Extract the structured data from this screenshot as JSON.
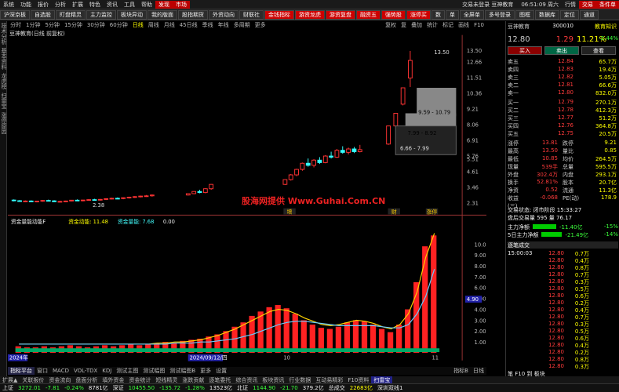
{
  "menu": {
    "items": [
      "系统",
      "功能",
      "报价",
      "分析",
      "扩展",
      "特色",
      "资讯",
      "工具",
      "帮助"
    ],
    "highlight": [
      "发现",
      "市场"
    ],
    "login_status": "交易未登录",
    "app_name": "豆神教育",
    "time": "06:51:09 周六",
    "right_buttons": [
      "行情",
      "交易",
      "条件单"
    ]
  },
  "toolbar": {
    "buttons": [
      "沪深京板",
      "自选股",
      "盯盘精灵",
      "主力监控",
      "板块异动",
      "我的版面",
      "股指期货",
      "外资动向",
      "财联社",
      "金钱指标",
      "游资龙虎",
      "游资复盘",
      "融资五",
      "强势股",
      "涨停买",
      "数",
      "单",
      "全屏单",
      "多号登录",
      "图框",
      "数据库",
      "定位",
      "通道"
    ]
  },
  "tabs": [
    "分时",
    "1分钟",
    "5分钟",
    "15分钟",
    "30分钟",
    "60分钟",
    "日线",
    "周线",
    "月线",
    "45日线",
    "季线",
    "年线",
    "多周期",
    "更多"
  ],
  "tabs_active": "日线",
  "tabs_right": [
    "复权",
    "复",
    "叠加",
    "统计",
    "标记",
    "画线",
    "F10"
  ],
  "chart_title": "豆神教育(日线 前复权)",
  "price_axis": [
    "13.50",
    "12.66",
    "11.51",
    "10.36",
    "9.21",
    "8.06",
    "6.91",
    "5.76",
    "5.51",
    "4.61",
    "3.46",
    "2.31"
  ],
  "price_annotations": {
    "high": "13.50",
    "low": "2.38",
    "range1": "9.59 - 10.79",
    "range2": "7.99 - 8.92",
    "range3": "6.66 - 7.99"
  },
  "event_markers": [
    "增",
    "财",
    "涨停"
  ],
  "watermark": "股海网提供 Www.Guhai.Com.CN",
  "indicator": {
    "title": "资金量能动能F",
    "label1": "资金动能: 11.48",
    "label2": "资金量能: 7.68",
    "label3": "0.00",
    "axis": [
      "10.00",
      "9.00",
      "8.00",
      "7.00",
      "6.00",
      "5.00",
      "4.00",
      "3.00",
      "2.00",
      "1.00"
    ],
    "current": "4.90"
  },
  "date_labels": [
    "2024年",
    "2024/09/12/四",
    "10",
    "11"
  ],
  "indicator_tabs": [
    "指标平台",
    "窗口",
    "MACD",
    "VOL-TDX",
    "KDJ",
    "测试主图",
    "测试幅图",
    "测试幅图B",
    "更多",
    "设置"
  ],
  "indicator_tabs_right": [
    "指标B",
    "日线"
  ],
  "bottom_tabs": [
    "扩展▲",
    "关联报价",
    "资金流向",
    "盘面分析",
    "填外资金",
    "资金统计",
    "短线精灵",
    "涨跌贡献",
    "逐笔委托",
    "综合资讯",
    "板块资讯",
    "行业数据",
    "互动易精彩",
    "F10资料"
  ],
  "bottom_tabs_right": [
    "扫雷宝"
  ],
  "status": {
    "sh_label": "上证",
    "sh_val": "3272.01",
    "sh_chg": "-7.81",
    "sh_pct": "-0.24%",
    "sh_amt": "8781亿",
    "sz_label": "深证",
    "sz_val": "10455.50",
    "sz_chg": "-135.72",
    "sz_pct": "-1.28%",
    "sz_amt": "13523亿",
    "bj_label": "北证",
    "bj_val": "1144.90",
    "bj_chg": "-21.70",
    "bj_amt": "379.2亿",
    "total_label": "总成交",
    "total_val": "22683亿",
    "link": "深圳双线1"
  },
  "quote": {
    "name": "豆神教育",
    "code": "300010",
    "price": "12.80",
    "change": "1.29",
    "change_pct": "11.21%",
    "header_tag": "教育知识",
    "header_pct": "-2.44%",
    "buttons": [
      "买入",
      "卖出",
      "查看"
    ],
    "asks": [
      {
        "label": "卖五",
        "price": "12.84",
        "vol": "65.7万"
      },
      {
        "label": "卖四",
        "price": "12.83",
        "vol": "19.4万"
      },
      {
        "label": "卖三",
        "price": "12.82",
        "vol": "5.05万"
      },
      {
        "label": "卖二",
        "price": "12.81",
        "vol": "66.6万"
      },
      {
        "label": "卖一",
        "price": "12.80",
        "vol": "832.0万"
      }
    ],
    "bids": [
      {
        "label": "买一",
        "price": "12.79",
        "vol": "270.1万"
      },
      {
        "label": "买二",
        "price": "12.78",
        "vol": "412.3万"
      },
      {
        "label": "买三",
        "price": "12.77",
        "vol": "51.2万"
      },
      {
        "label": "买四",
        "price": "12.76",
        "vol": "364.8万"
      },
      {
        "label": "买五",
        "price": "12.75",
        "vol": "20.5万"
      }
    ],
    "stats": [
      {
        "l1": "涨停",
        "v1": "13.81",
        "l2": "跌停",
        "v2": "9.21"
      },
      {
        "l1": "最高",
        "v1": "13.50",
        "l2": "量比",
        "v2": "0.85"
      },
      {
        "l1": "最低",
        "v1": "10.85",
        "l2": "均价",
        "v2": "264.5万"
      },
      {
        "l1": "现量",
        "v1": "539手",
        "l2": "总量",
        "v2": "595.5万"
      },
      {
        "l1": "外盘",
        "v1": "302.4万",
        "l2": "内盘",
        "v2": "293.1万"
      },
      {
        "l1": "换手",
        "v1": "52.81%",
        "l2": "股本",
        "v2": "20.7亿"
      },
      {
        "l1": "净资",
        "v1": "0.52",
        "l2": "流通",
        "v2": "11.3亿"
      },
      {
        "l1": "收益(三)",
        "v1": "-0.068",
        "l2": "PE(动)",
        "v2": "178.9"
      }
    ],
    "status_line": "交易状态: 闭市阶段 15:33:27",
    "after_hours": "盘后交易量 595 量 76.17",
    "main_net1_label": "主力净额",
    "main_net1_val": "-11.40亿",
    "main_net1_pct": "-15%",
    "main_net5_label": "5日主力净额",
    "main_net5_val": "-21.49亿",
    "main_net5_pct": "-14%"
  },
  "trades": {
    "title": "逐笔成交",
    "rows": [
      {
        "t": "15:00:03",
        "p": "12.80",
        "v": "0.7万"
      },
      {
        "t": "",
        "p": "12.80",
        "v": "0.4万"
      },
      {
        "t": "",
        "p": "12.80",
        "v": "0.8万"
      },
      {
        "t": "",
        "p": "12.80",
        "v": "0.7万"
      },
      {
        "t": "",
        "p": "12.80",
        "v": "0.3万"
      },
      {
        "t": "",
        "p": "12.80",
        "v": "0.5万"
      },
      {
        "t": "",
        "p": "12.80",
        "v": "0.6万"
      },
      {
        "t": "",
        "p": "12.80",
        "v": "0.2万"
      },
      {
        "t": "",
        "p": "12.80",
        "v": "0.4万"
      },
      {
        "t": "",
        "p": "12.80",
        "v": "0.7万"
      },
      {
        "t": "",
        "p": "12.80",
        "v": "0.3万"
      },
      {
        "t": "",
        "p": "12.80",
        "v": "0.5万"
      },
      {
        "t": "",
        "p": "12.80",
        "v": "0.6万"
      },
      {
        "t": "",
        "p": "12.80",
        "v": "0.4万"
      },
      {
        "t": "",
        "p": "12.80",
        "v": "0.2万"
      },
      {
        "t": "",
        "p": "12.80",
        "v": "0.8万"
      },
      {
        "t": "",
        "p": "12.80",
        "v": "0.3万"
      }
    ],
    "footer": "笔 F10 到 板块"
  },
  "candles": [
    [
      2.55,
      2.6,
      2.45,
      2.5
    ],
    [
      2.5,
      2.55,
      2.42,
      2.46
    ],
    [
      2.46,
      2.52,
      2.4,
      2.48
    ],
    [
      2.48,
      2.53,
      2.41,
      2.44
    ],
    [
      2.44,
      2.5,
      2.38,
      2.47
    ],
    [
      2.47,
      2.55,
      2.43,
      2.52
    ],
    [
      2.52,
      2.58,
      2.46,
      2.49
    ],
    [
      2.49,
      2.54,
      2.4,
      2.43
    ],
    [
      2.43,
      2.5,
      2.38,
      2.45
    ],
    [
      2.45,
      2.51,
      2.4,
      2.48
    ],
    [
      2.48,
      2.56,
      2.45,
      2.54
    ],
    [
      2.54,
      2.6,
      2.48,
      2.51
    ],
    [
      2.51,
      2.57,
      2.46,
      2.55
    ],
    [
      2.55,
      2.62,
      2.5,
      2.58
    ],
    [
      2.58,
      2.64,
      2.52,
      2.56
    ],
    [
      2.56,
      2.63,
      2.51,
      2.6
    ],
    [
      2.6,
      2.68,
      2.55,
      2.65
    ],
    [
      2.65,
      2.72,
      2.6,
      2.68
    ],
    [
      2.68,
      2.74,
      2.62,
      2.66
    ],
    [
      2.66,
      2.75,
      2.61,
      2.72
    ],
    [
      2.72,
      2.8,
      2.66,
      2.76
    ],
    [
      2.76,
      2.84,
      2.7,
      2.8
    ],
    [
      2.8,
      2.88,
      2.74,
      2.84
    ],
    [
      2.84,
      2.92,
      2.78,
      2.86
    ],
    [
      2.86,
      2.96,
      2.8,
      2.92
    ],
    [
      2.92,
      3.05,
      2.88,
      3.02
    ],
    [
      3.02,
      3.2,
      2.98,
      3.18
    ],
    [
      3.18,
      3.3,
      3.05,
      3.1
    ],
    [
      3.1,
      3.42,
      3.05,
      3.38
    ],
    [
      3.38,
      3.72,
      3.3,
      3.7
    ],
    [
      3.7,
      4.07,
      3.65,
      4.05
    ],
    [
      4.05,
      4.46,
      3.98,
      4.4
    ],
    [
      4.4,
      4.85,
      4.3,
      4.8
    ],
    [
      4.8,
      5.3,
      4.7,
      5.25
    ],
    [
      5.25,
      5.6,
      5.0,
      5.1
    ],
    [
      5.1,
      5.55,
      4.95,
      5.48
    ],
    [
      5.48,
      5.7,
      5.2,
      5.3
    ],
    [
      5.3,
      5.85,
      5.25,
      5.78
    ],
    [
      5.78,
      6.1,
      5.6,
      5.7
    ],
    [
      5.7,
      6.3,
      5.65,
      6.2
    ],
    [
      6.2,
      6.5,
      5.95,
      6.05
    ],
    [
      6.05,
      6.4,
      5.9,
      6.3
    ],
    [
      6.3,
      6.45,
      6.0,
      6.1
    ],
    [
      6.1,
      6.6,
      6.05,
      6.25
    ],
    [
      6.66,
      7.99,
      6.6,
      7.99
    ],
    [
      7.99,
      8.92,
      7.9,
      8.92
    ],
    [
      9.59,
      10.79,
      9.5,
      10.79
    ],
    [
      11.51,
      13.5,
      10.85,
      12.8
    ]
  ],
  "vol_bars": [
    0.6,
    0.5,
    0.5,
    0.6,
    0.5,
    0.6,
    0.7,
    0.6,
    0.5,
    0.6,
    0.7,
    0.6,
    0.7,
    0.8,
    0.7,
    0.8,
    0.9,
    1.0,
    0.9,
    1.1,
    1.2,
    1.3,
    1.5,
    1.7,
    2.0,
    2.4,
    2.8,
    3.4,
    3.8,
    4.2,
    4.4,
    4.1,
    3.6,
    3.0,
    2.6,
    2.3,
    2.2,
    2.4,
    2.8,
    3.0,
    2.9,
    2.6,
    2.2,
    1.9,
    2.6,
    4.0,
    6.5,
    9.8,
    10.8
  ],
  "vol_line": [
    0.8,
    0.8,
    0.8,
    0.8,
    0.8,
    0.8,
    0.8,
    0.8,
    0.8,
    0.8,
    0.8,
    0.8,
    0.8,
    0.8,
    0.8,
    0.8,
    0.9,
    0.9,
    1.0,
    1.0,
    1.1,
    1.2,
    1.4,
    1.6,
    1.9,
    2.2,
    2.6,
    3.0,
    3.4,
    3.8,
    4.0,
    3.9,
    3.6,
    3.2,
    2.9,
    2.6,
    2.5,
    2.6,
    2.8,
    3.0,
    2.9,
    2.7,
    2.4,
    2.2,
    2.6,
    3.6,
    5.6,
    8.8,
    11.0
  ],
  "slow_line": [
    0.8,
    0.8,
    0.8,
    0.8,
    0.8,
    0.8,
    0.8,
    0.8,
    0.8,
    0.8,
    0.8,
    0.8,
    0.8,
    0.8,
    0.8,
    0.8,
    0.8,
    0.8,
    0.9,
    0.9,
    0.9,
    1.0,
    1.0,
    1.1,
    1.2,
    1.3,
    1.5,
    1.7,
    2.0,
    2.3,
    2.6,
    2.8,
    2.9,
    2.9,
    2.8,
    2.7,
    2.6,
    2.5,
    2.5,
    2.5,
    2.5,
    2.5,
    2.4,
    2.3,
    2.3,
    2.6,
    3.6,
    5.2,
    7.7
  ]
}
